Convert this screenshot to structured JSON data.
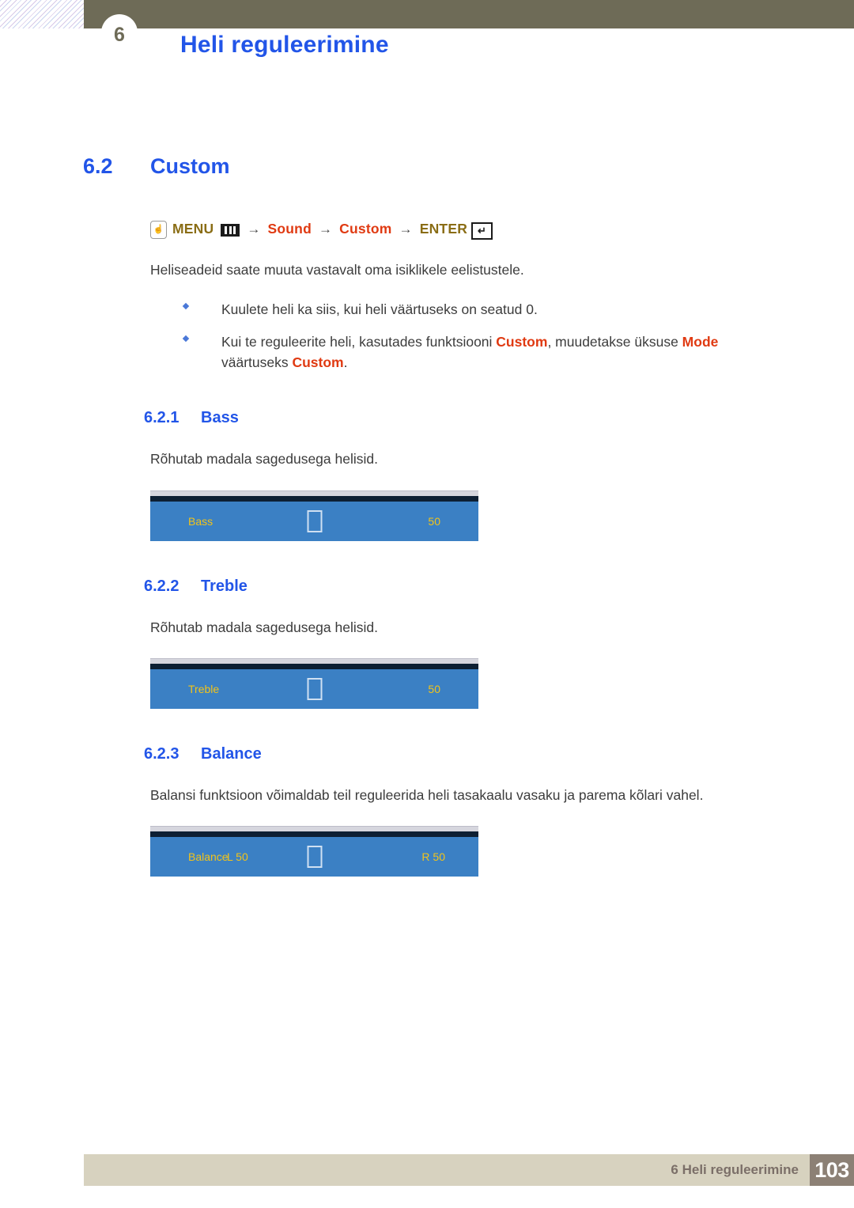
{
  "header": {
    "chapter_number": "6",
    "title": "Heli reguleerimine"
  },
  "section": {
    "number": "6.2",
    "title": "Custom"
  },
  "menu_path": {
    "hand_icon": "hand-press-icon",
    "menu_label": "MENU",
    "bars_icon": "menu-bars-icon",
    "arrow1": "→",
    "sound_label": "Sound",
    "arrow2": "→",
    "custom_label": "Custom",
    "arrow3": "→",
    "enter_label": "ENTER",
    "enter_icon": "enter-key-icon"
  },
  "intro_paragraph": "Heliseadeid saate muuta vastavalt oma isiklikele eelistustele.",
  "bullets": [
    {
      "parts": [
        {
          "text": "Kuulete heli ka siis, kui heli väärtuseks on seatud 0.",
          "highlight": false
        }
      ]
    },
    {
      "parts": [
        {
          "text": "Kui te reguleerite heli, kasutades funktsiooni ",
          "highlight": false
        },
        {
          "text": "Custom",
          "highlight": true
        },
        {
          "text": ", muudetakse üksuse ",
          "highlight": false
        },
        {
          "text": "Mode",
          "highlight": true
        },
        {
          "text": " väärtuseks ",
          "highlight": false
        },
        {
          "text": "Custom",
          "highlight": true
        },
        {
          "text": ".",
          "highlight": false
        }
      ]
    }
  ],
  "subsections": [
    {
      "number": "6.2.1",
      "title": "Bass",
      "description": "Rõhutab madala sagedusega helisid.",
      "osd": {
        "label": "Bass",
        "sublabel": "",
        "value": "50"
      }
    },
    {
      "number": "6.2.2",
      "title": "Treble",
      "description": "Rõhutab madala sagedusega helisid.",
      "osd": {
        "label": "Treble",
        "sublabel": "",
        "value": "50"
      }
    },
    {
      "number": "6.2.3",
      "title": "Balance",
      "description": "Balansi funktsioon võimaldab teil reguleerida heli tasakaalu vasaku ja parema kõlari vahel.",
      "osd": {
        "label": "Balance",
        "sublabel": "L 50",
        "value": "R 50"
      }
    }
  ],
  "footer": {
    "text": "6 Heli reguleerimine",
    "page_number": "103"
  },
  "colors": {
    "heading_blue": "#2255e8",
    "keyword_red": "#e03a12",
    "keyword_gold": "#8a6d15",
    "olive": "#6e6b57",
    "osd_blue": "#3b80c4",
    "osd_gold": "#f2c319",
    "footer_beige": "#d7d2bf",
    "footer_page_brown": "#8c8075"
  }
}
